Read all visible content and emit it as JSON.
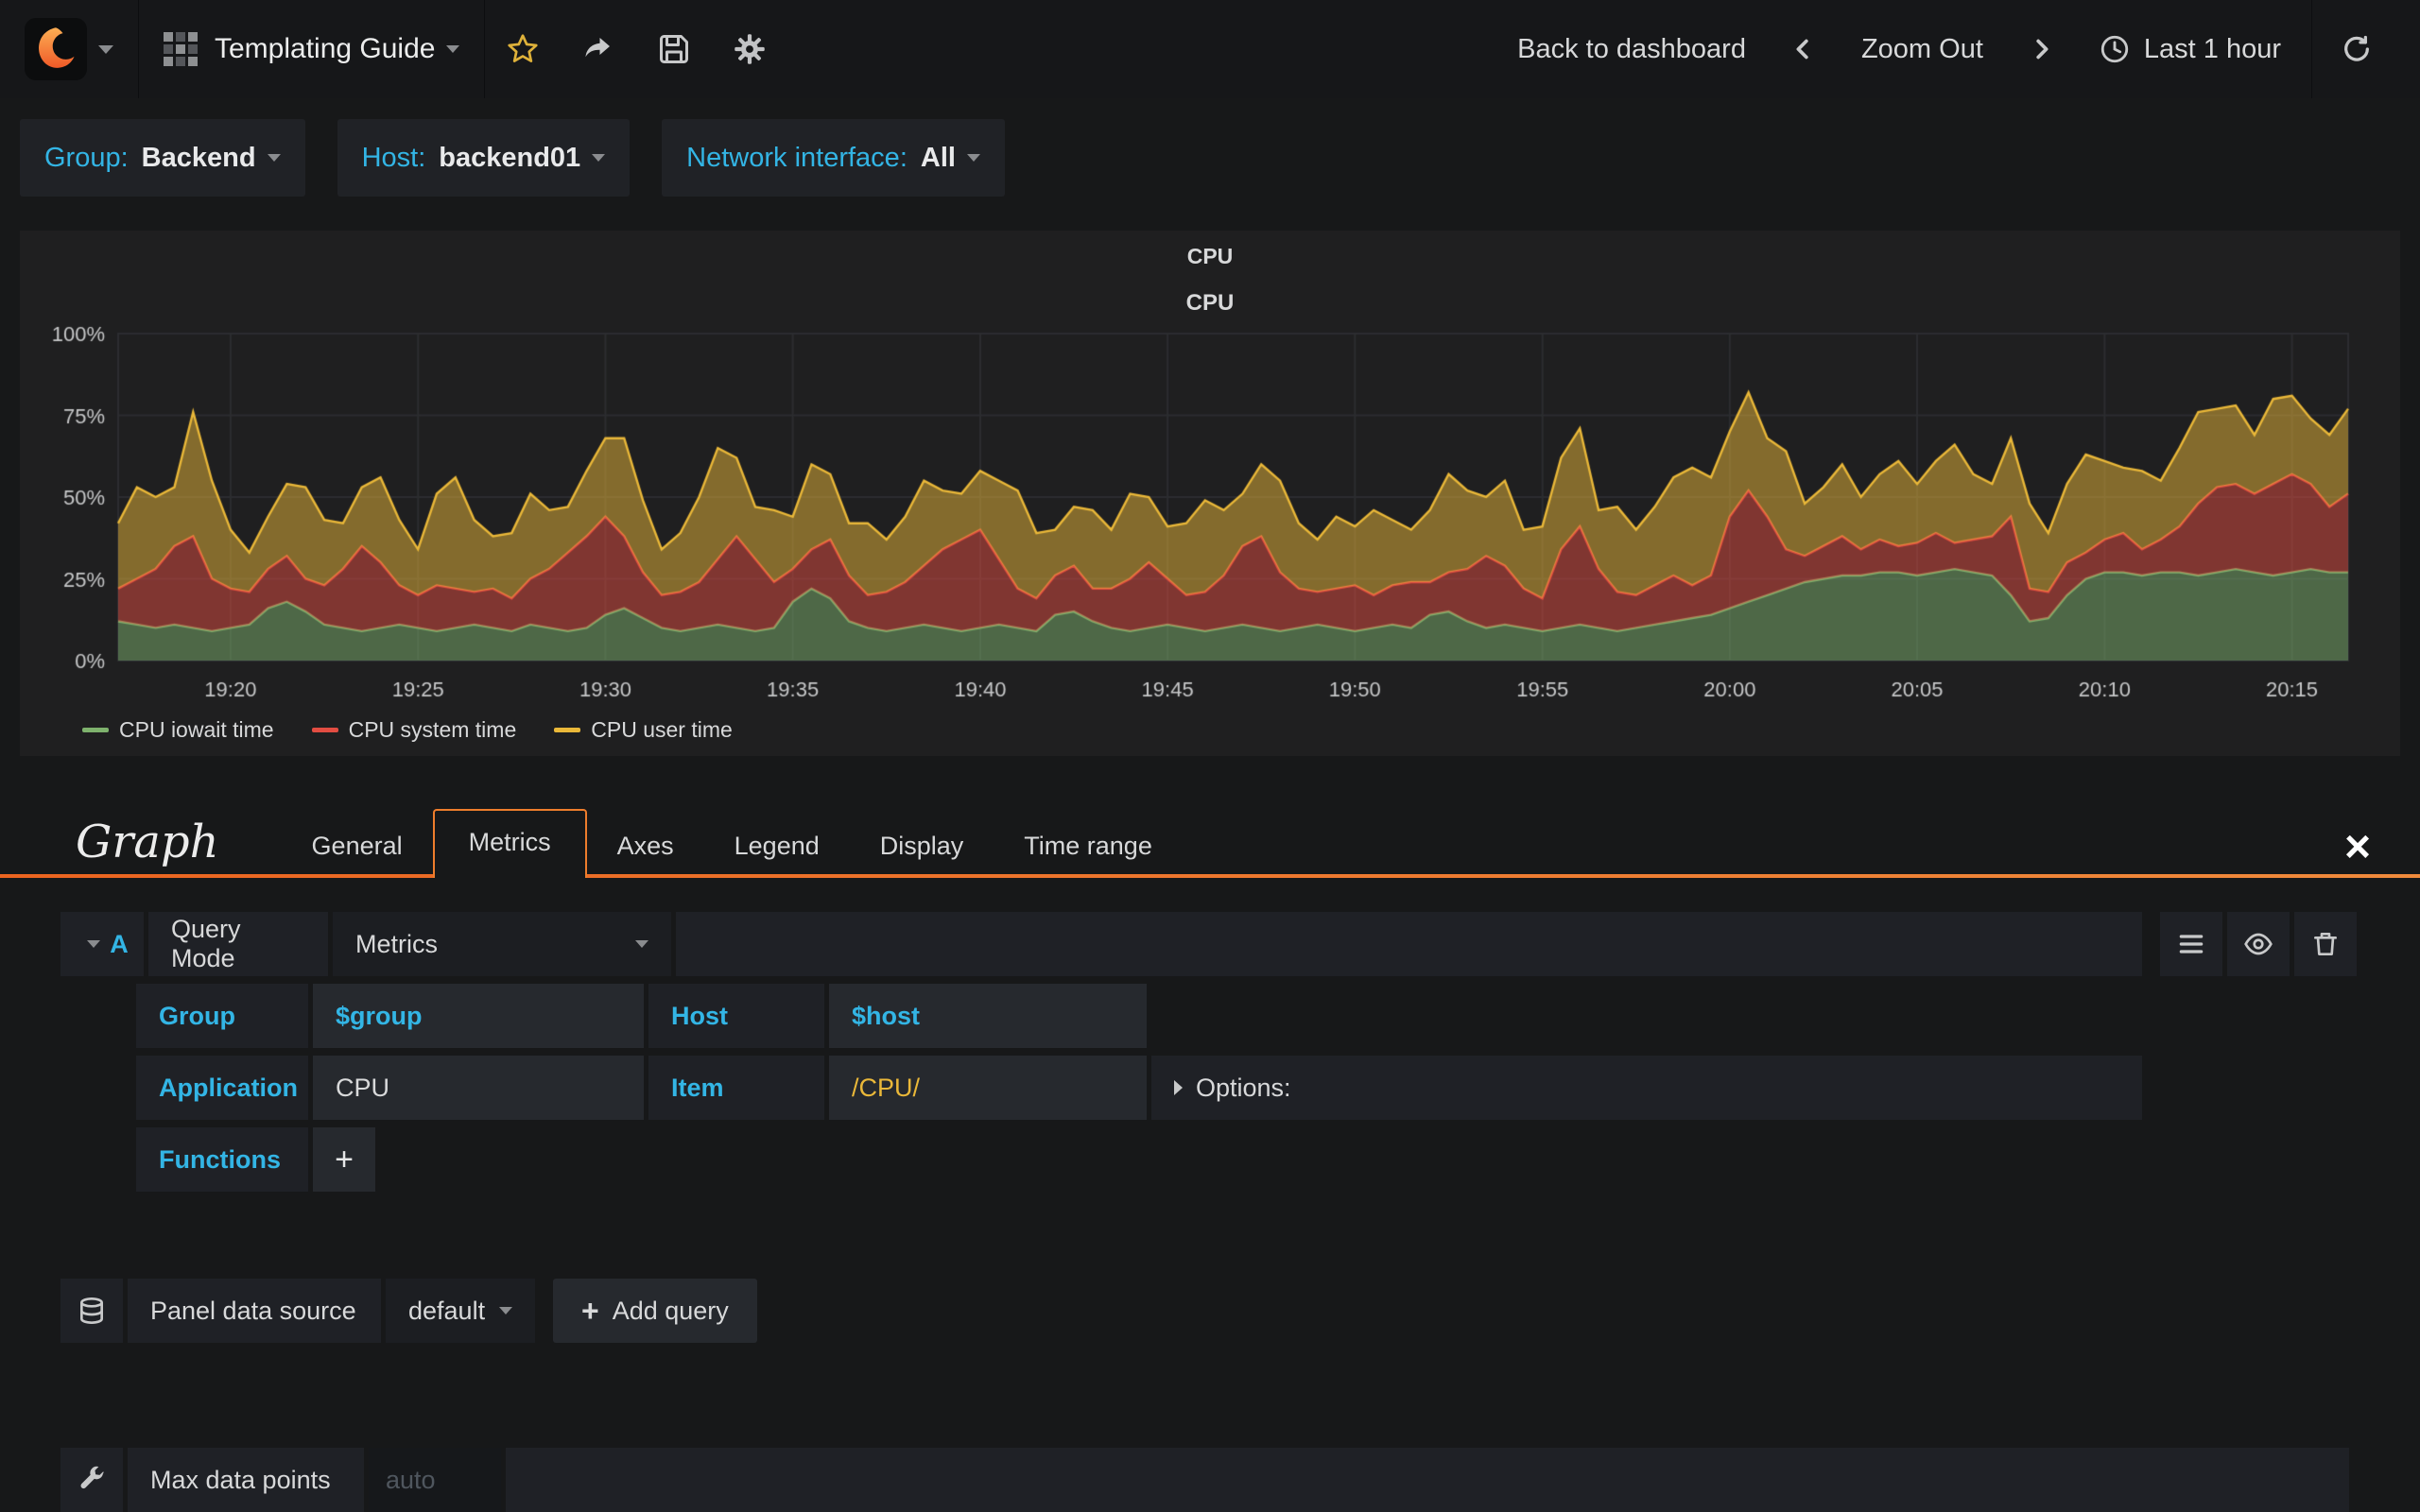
{
  "navbar": {
    "dashboard_title": "Templating Guide",
    "back_to_dashboard": "Back to dashboard",
    "zoom_out": "Zoom Out",
    "time_range": "Last 1 hour"
  },
  "icons": {
    "close": "×",
    "plus": "+"
  },
  "variables": [
    {
      "label": "Group:",
      "value": "Backend"
    },
    {
      "label": "Host:",
      "value": "backend01"
    },
    {
      "label": "Network interface:",
      "value": "All"
    }
  ],
  "panel": {
    "title": "CPU"
  },
  "editor": {
    "panel_type": "Graph",
    "tabs": [
      "General",
      "Metrics",
      "Axes",
      "Legend",
      "Display",
      "Time range"
    ],
    "active_tab": "Metrics",
    "query": {
      "letter": "A",
      "query_mode_label": "Query Mode",
      "query_mode_value": "Metrics",
      "fields": [
        {
          "label": "Group",
          "value": "$group"
        },
        {
          "label": "Host",
          "value": "$host"
        },
        {
          "label": "Application",
          "value": "CPU"
        },
        {
          "label": "Item",
          "value": "/CPU/"
        }
      ],
      "options_label": "Options:",
      "functions_label": "Functions"
    },
    "datasource": {
      "label": "Panel data source",
      "value": "default",
      "add_query_label": "Add query"
    },
    "max_data_points": {
      "label": "Max data points",
      "placeholder": "auto"
    }
  },
  "chart_data": {
    "type": "area",
    "stacked": true,
    "title": "CPU",
    "x_start": "19:17",
    "x_end": "20:17",
    "x_ticks": [
      "19:20",
      "19:25",
      "19:30",
      "19:35",
      "19:40",
      "19:45",
      "19:50",
      "19:55",
      "20:00",
      "20:05",
      "20:10",
      "20:15"
    ],
    "x_tick_fracs": [
      0.0504,
      0.1345,
      0.2185,
      0.3025,
      0.3866,
      0.4706,
      0.5546,
      0.6387,
      0.7227,
      0.8067,
      0.8908,
      0.9748
    ],
    "y_ticks": [
      "0%",
      "25%",
      "50%",
      "75%",
      "100%"
    ],
    "y_tick_values": [
      0,
      25,
      50,
      75,
      100
    ],
    "ylim": [
      0,
      100
    ],
    "unit": "percent",
    "legend_position": "bottom-left",
    "grid": true,
    "series": [
      {
        "name": "CPU iowait time",
        "color": "#7eb26d",
        "values": [
          12,
          11,
          10,
          11,
          10,
          9,
          10,
          11,
          16,
          18,
          15,
          11,
          10,
          9,
          10,
          11,
          10,
          9,
          10,
          11,
          10,
          9,
          11,
          10,
          9,
          10,
          14,
          16,
          13,
          10,
          9,
          10,
          11,
          10,
          9,
          10,
          18,
          22,
          19,
          12,
          10,
          9,
          10,
          11,
          10,
          9,
          10,
          11,
          10,
          9,
          14,
          15,
          12,
          10,
          9,
          10,
          11,
          10,
          9,
          10,
          11,
          10,
          9,
          10,
          11,
          10,
          9,
          10,
          11,
          10,
          14,
          15,
          12,
          10,
          11,
          10,
          9,
          10,
          11,
          10,
          9,
          10,
          11,
          12,
          13,
          14,
          16,
          18,
          20,
          22,
          24,
          25,
          26,
          26,
          27,
          27,
          26,
          27,
          28,
          27,
          26,
          20,
          12,
          13,
          20,
          25,
          27,
          27,
          26,
          27,
          27,
          26,
          27,
          28,
          27,
          26,
          27,
          28,
          27,
          27
        ]
      },
      {
        "name": "CPU system time",
        "color": "#e24d42",
        "values": [
          10,
          14,
          18,
          24,
          28,
          16,
          12,
          10,
          12,
          14,
          10,
          12,
          18,
          26,
          20,
          12,
          10,
          14,
          12,
          10,
          12,
          10,
          14,
          18,
          24,
          28,
          30,
          22,
          14,
          10,
          12,
          14,
          20,
          28,
          22,
          14,
          10,
          12,
          18,
          14,
          10,
          12,
          14,
          18,
          24,
          28,
          30,
          20,
          12,
          10,
          12,
          14,
          10,
          12,
          16,
          20,
          14,
          10,
          12,
          16,
          24,
          28,
          18,
          12,
          10,
          12,
          14,
          10,
          12,
          14,
          10,
          12,
          16,
          22,
          18,
          12,
          10,
          24,
          30,
          18,
          12,
          10,
          12,
          14,
          10,
          12,
          28,
          34,
          24,
          12,
          8,
          10,
          12,
          8,
          10,
          8,
          10,
          12,
          8,
          10,
          12,
          24,
          10,
          8,
          10,
          8,
          10,
          12,
          8,
          10,
          14,
          22,
          26,
          26,
          24,
          28,
          30,
          26,
          20,
          24
        ]
      },
      {
        "name": "CPU user time",
        "color": "#eab839",
        "values": [
          20,
          28,
          22,
          18,
          38,
          30,
          18,
          12,
          16,
          22,
          28,
          20,
          14,
          18,
          26,
          20,
          14,
          28,
          34,
          22,
          16,
          20,
          26,
          18,
          14,
          20,
          24,
          30,
          22,
          14,
          18,
          26,
          34,
          24,
          16,
          22,
          16,
          26,
          20,
          16,
          22,
          16,
          20,
          26,
          18,
          14,
          18,
          24,
          30,
          20,
          14,
          18,
          24,
          18,
          26,
          20,
          16,
          22,
          28,
          20,
          16,
          22,
          28,
          20,
          16,
          22,
          18,
          26,
          20,
          16,
          22,
          30,
          24,
          18,
          26,
          18,
          22,
          28,
          30,
          18,
          26,
          20,
          24,
          30,
          36,
          30,
          26,
          30,
          24,
          30,
          16,
          18,
          22,
          16,
          20,
          26,
          18,
          22,
          30,
          20,
          16,
          24,
          26,
          18,
          24,
          30,
          24,
          20,
          24,
          18,
          24,
          28,
          24,
          24,
          18,
          26,
          24,
          20,
          22,
          26
        ]
      }
    ]
  }
}
